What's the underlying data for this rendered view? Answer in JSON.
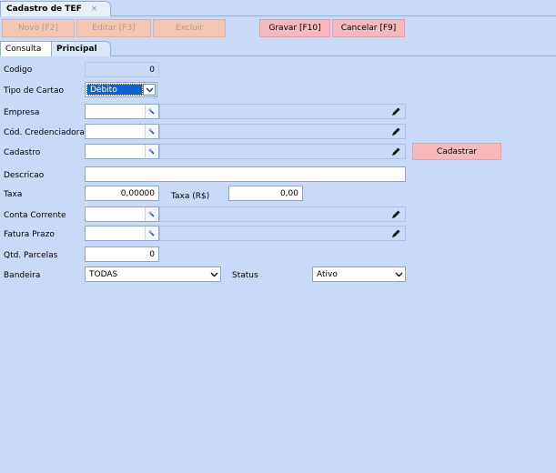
{
  "doc_tab": {
    "title": "Cadastro de TEF",
    "close": "×"
  },
  "toolbar": {
    "novo": "Novo [F2]",
    "editar": "Editar [F3]",
    "excluir": "Excluir",
    "gravar": "Gravar [F10]",
    "cancelar": "Cancelar [F9]"
  },
  "tabs": {
    "consulta": "Consulta",
    "principal": "Principal"
  },
  "form": {
    "codigo": {
      "label": "Codigo",
      "value": "0"
    },
    "tipo_cartao": {
      "label": "Tipo de Cartao",
      "value": "Débito"
    },
    "empresa": {
      "label": "Empresa",
      "value": ""
    },
    "cod_credenciadora": {
      "label": "Cód. Credenciadora",
      "value": ""
    },
    "cadastro": {
      "label": "Cadastro",
      "value": "",
      "button": "Cadastrar"
    },
    "descricao": {
      "label": "Descricao",
      "value": ""
    },
    "taxa": {
      "label": "Taxa",
      "value": "0,00000"
    },
    "taxa_rs": {
      "label": "Taxa (R$)",
      "value": "0,00"
    },
    "conta_corrente": {
      "label": "Conta Corrente",
      "value": ""
    },
    "fatura_prazo": {
      "label": "Fatura Prazo",
      "value": ""
    },
    "qtd_parcelas": {
      "label": "Qtd. Parcelas",
      "value": "0"
    },
    "bandeira": {
      "label": "Bandeira",
      "value": "TODAS"
    },
    "status": {
      "label": "Status",
      "value": "Ativo"
    }
  },
  "colors": {
    "background": "#c9daf8",
    "action_button": "#f7b9be",
    "disabled_button": "#f4c6b4",
    "selection": "#0a64d4"
  }
}
